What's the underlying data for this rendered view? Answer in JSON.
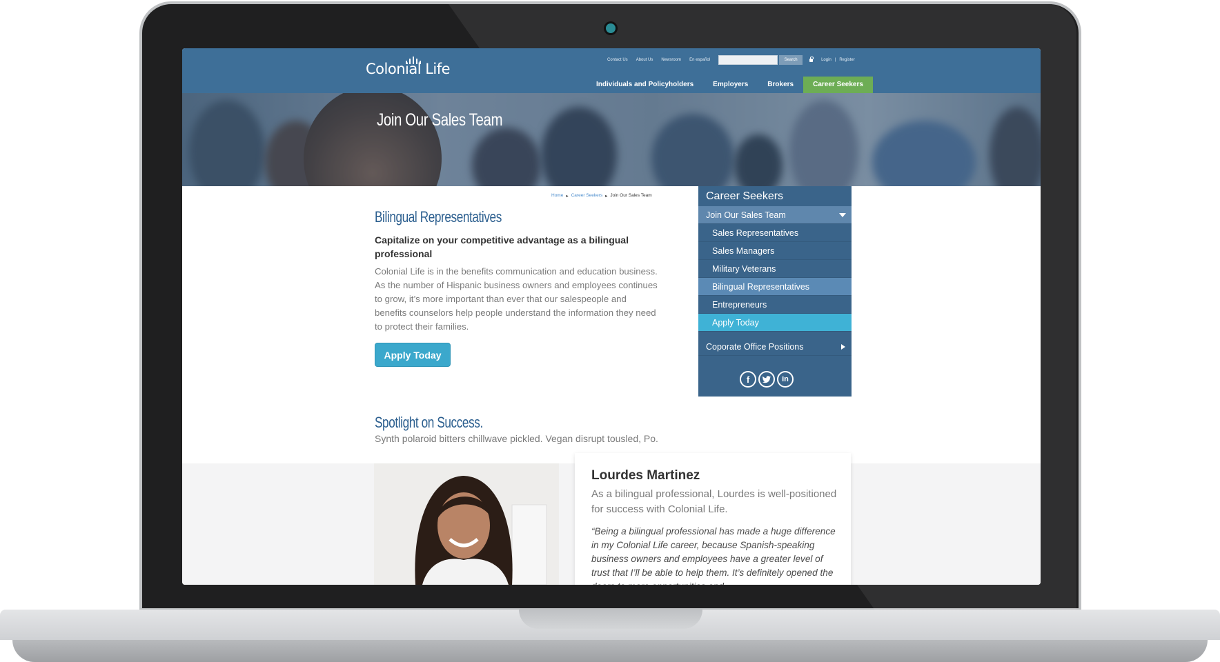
{
  "header": {
    "logo": "Colonial Life",
    "utility_links": [
      "Contact Us",
      "About Us",
      "Newsroom",
      "En español"
    ],
    "search_button": "Search",
    "search_placeholder": "",
    "login": "Login",
    "register": "Register",
    "nav": [
      "Individuals and Policyholders",
      "Employers",
      "Brokers",
      "Career Seekers"
    ],
    "active_nav": "Career Seekers",
    "active_color": "#6dad55",
    "brand_color": "#3e6f98"
  },
  "hero": {
    "title": "Join Our Sales Team"
  },
  "breadcrumb": [
    "Home",
    "Career Seekers",
    "Join Our Sales Team"
  ],
  "main": {
    "heading": "Bilingual Representatives",
    "lead": "Capitalize on your competitive advantage as a bilingual professional",
    "body": "Colonial Life is in the benefits communication and education business. As the number of Hispanic business owners and employees continues to grow, it’s more important than ever that our salespeople and benefits counselors help people understand the information they need to protect their families.",
    "apply_button": "Apply Today",
    "spotlight_heading": "Spotlight on Success.",
    "spotlight_sub": "Synth polaroid bitters chillwave pickled. Vegan disrupt tousled, Po."
  },
  "testimonial": {
    "name": "Lourdes Martinez",
    "description": "As a bilingual professional, Lourdes is well-positioned for success with Colonial Life.",
    "quote": "“Being a bilingual professional has made a huge difference in my Colonial Life career, because Spanish-speaking business owners and employees have a greater level of trust that I’ll be able to help them. It’s definitely opened the doors to more opportunities and"
  },
  "sidebar": {
    "title": "Career Seekers",
    "parent": "Join Our Sales Team",
    "items": [
      "Sales Representatives",
      "Sales Managers",
      "Military Veterans",
      "Bilingual Representatives",
      "Entrepreneurs",
      "Apply Today"
    ],
    "selected": "Bilingual Representatives",
    "corporate": "Coporate Office Positions",
    "social_icons": [
      "facebook-icon",
      "twitter-icon",
      "linkedin-icon"
    ],
    "accent": "#3fb2d6"
  }
}
